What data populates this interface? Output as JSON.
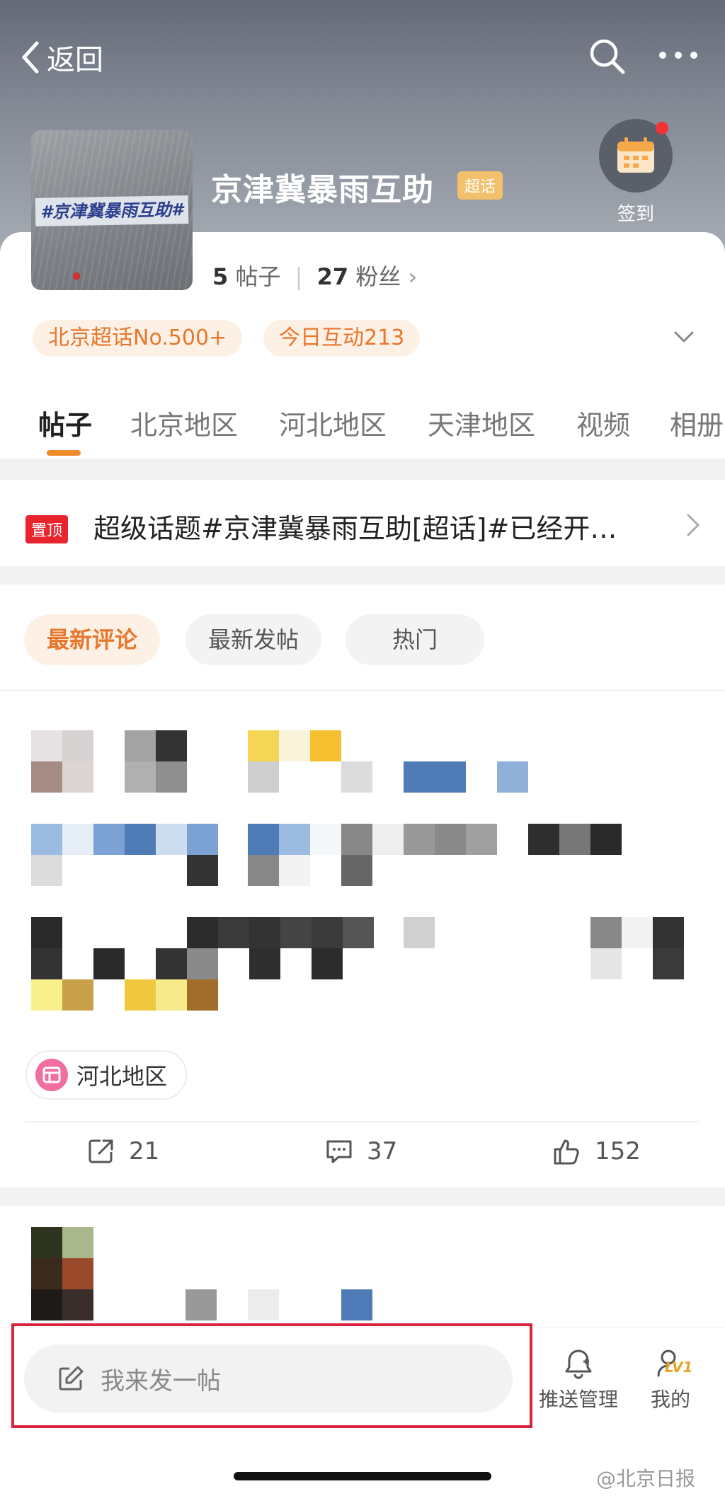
{
  "header": {
    "back_label": "返回",
    "title": "京津冀暴雨互助",
    "badge": "超话",
    "cover_text": "#京津冀暴雨互助#",
    "checkin_label": "签到"
  },
  "stats": {
    "posts_count": "5",
    "posts_label": "帖子",
    "fans_count": "27",
    "fans_label": "粉丝"
  },
  "tags": [
    "北京超话No.500+",
    "今日互动213"
  ],
  "tabs": [
    "帖子",
    "北京地区",
    "河北地区",
    "天津地区",
    "视频",
    "相册"
  ],
  "pinned": {
    "badge": "置顶",
    "text": "超级话题#京津冀暴雨互助[超话]#已经开…"
  },
  "sort": [
    "最新评论",
    "最新发帖",
    "热门"
  ],
  "post": {
    "location_tag": "河北地区",
    "repost_count": "21",
    "comment_count": "37",
    "like_count": "152"
  },
  "bottom": {
    "composer_placeholder": "我来发一帖",
    "push_label": "推送管理",
    "mine_label": "我的",
    "level_badge": "LV1"
  },
  "watermark": "@北京日报",
  "colors": {
    "accent_orange": "#e8772e",
    "pin_red": "#e8252f",
    "highlight_red": "#d8233a"
  }
}
